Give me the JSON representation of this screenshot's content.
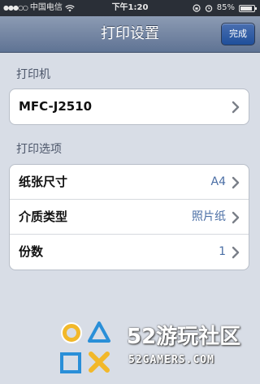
{
  "status_bar": {
    "carrier": "中国电信",
    "time": "下午1:20",
    "battery": "85%",
    "battery_level": 0.85
  },
  "nav": {
    "title": "打印设置",
    "done_label": "完成"
  },
  "printer_section": {
    "header": "打印机",
    "printer_name": "MFC-J2510"
  },
  "options_section": {
    "header": "打印选项",
    "rows": [
      {
        "label": "纸张尺寸",
        "value": "A4"
      },
      {
        "label": "介质类型",
        "value": "照片纸"
      },
      {
        "label": "份数",
        "value": "1"
      }
    ]
  },
  "watermark": {
    "brand": "52游玩社区",
    "url": "52GAMERS.COM"
  },
  "colors": {
    "nav_top": "#8c9bb3",
    "nav_bottom": "#5f7394",
    "done_button": "#1f4f9b",
    "value_text": "#4a6ea5",
    "background": "#d8dde6"
  }
}
